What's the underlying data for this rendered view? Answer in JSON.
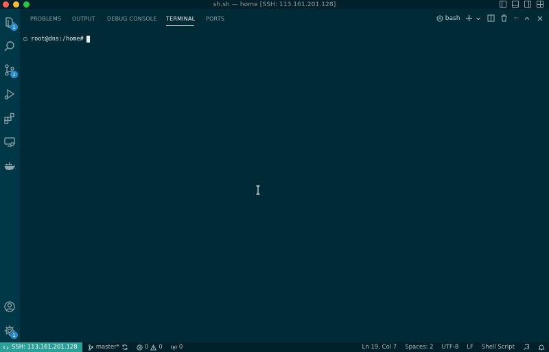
{
  "window": {
    "title": "sh.sh — home [SSH: 113.161.201.128]",
    "traffic_colors": [
      "#ff5f57",
      "#febc2e",
      "#28c840"
    ]
  },
  "activity_bar": {
    "items": [
      {
        "name": "explorer-icon",
        "badge": "1"
      },
      {
        "name": "search-icon",
        "badge": ""
      },
      {
        "name": "source-control-icon",
        "badge": "1"
      },
      {
        "name": "run-debug-icon",
        "badge": ""
      },
      {
        "name": "extensions-icon",
        "badge": ""
      },
      {
        "name": "remote-explorer-icon",
        "badge": ""
      },
      {
        "name": "docker-icon",
        "badge": ""
      }
    ],
    "bottom": [
      {
        "name": "account-icon",
        "badge": ""
      },
      {
        "name": "settings-gear-icon",
        "badge": "1"
      }
    ]
  },
  "panel": {
    "tabs": [
      "PROBLEMS",
      "OUTPUT",
      "DEBUG CONSOLE",
      "TERMINAL",
      "PORTS"
    ],
    "active_tab": "TERMINAL",
    "shell_label": "bash",
    "more": "···"
  },
  "terminal": {
    "prompt": "root@dns:/home#"
  },
  "status_bar": {
    "remote": "SSH: 113.161.201.128",
    "branch": "master*",
    "errors": "0",
    "warnings": "0",
    "ports": "0",
    "position": "Ln 19, Col 7",
    "spaces": "Spaces: 2",
    "encoding": "UTF-8",
    "eol": "LF",
    "language": "Shell Script",
    "accent": "#2aa198"
  }
}
